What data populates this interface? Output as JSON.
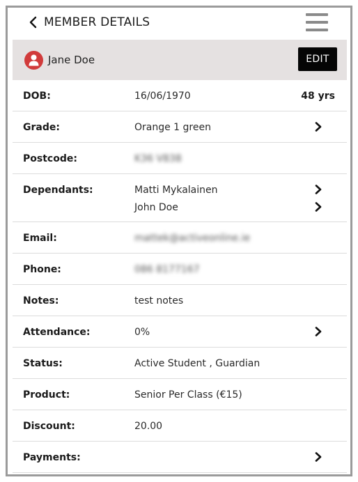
{
  "header": {
    "title": "MEMBER DETAILS",
    "back_icon": "chevron-left-icon",
    "menu_icon": "hamburger-menu-icon"
  },
  "member": {
    "name": "Jane Doe",
    "avatar_icon": "user-icon",
    "avatar_color": "#d13b3b",
    "edit_label": "EDIT"
  },
  "fields": {
    "dob": {
      "label": "DOB:",
      "value": "16/06/1970",
      "age": "48 yrs"
    },
    "grade": {
      "label": "Grade:",
      "value": "Orange 1 green"
    },
    "postcode": {
      "label": "Postcode:",
      "value": "K36 V838"
    },
    "dependants": {
      "label": "Dependants:",
      "items": [
        "Matti Mykalainen",
        "John Doe"
      ]
    },
    "email": {
      "label": "Email:",
      "value": "mattek@activeonline.ie"
    },
    "phone": {
      "label": "Phone:",
      "value": "086 8177167"
    },
    "notes": {
      "label": "Notes:",
      "value": "test notes"
    },
    "attendance": {
      "label": "Attendance:",
      "value": "0%"
    },
    "status": {
      "label": "Status:",
      "value": "Active Student , Guardian"
    },
    "product": {
      "label": "Product:",
      "value": "Senior Per Class (€15)"
    },
    "discount": {
      "label": "Discount:",
      "value": "20.00"
    },
    "payments": {
      "label": "Payments:"
    }
  },
  "colors": {
    "member_bar_bg": "#e5e1e1",
    "edit_bg": "#050505",
    "menu_icon": "#8a8a8a",
    "frame_border": "#9b9b9b"
  }
}
